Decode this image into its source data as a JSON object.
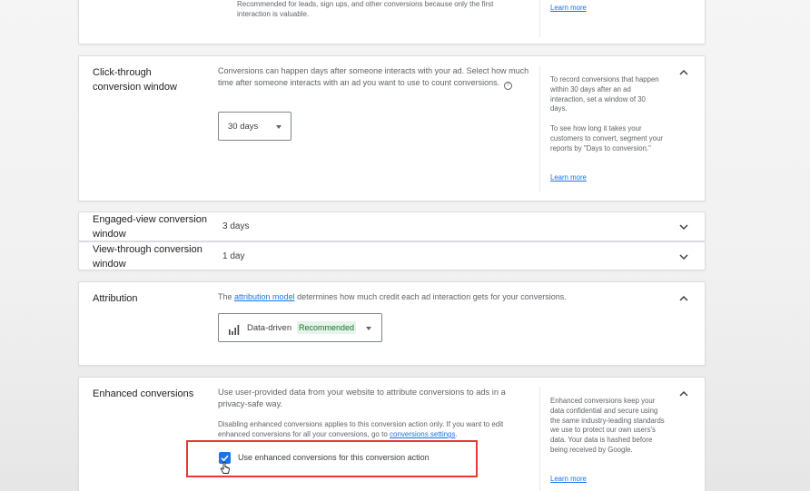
{
  "conversion_type_card": {
    "partial_text": "Recommended for leads, sign ups, and other conversions because only the first interaction is valuable.",
    "learn_more": "Learn more"
  },
  "click_through": {
    "title": "Click-through conversion window",
    "description": "Conversions can happen days after someone interacts with your ad. Select how much time after someone interacts with an ad you want to use to count conversions.",
    "select_value": "30 days",
    "help_para1": "To record conversions that happen within 30 days after an ad interaction, set a window of 30 days.",
    "help_para2": "To see how long it takes your customers to convert, segment your reports by \"Days to conversion.\"",
    "learn_more": "Learn more"
  },
  "engaged_view": {
    "title": "Engaged-view conversion window",
    "value": "3 days"
  },
  "view_through": {
    "title": "View-through conversion window",
    "value": "1 day"
  },
  "attribution": {
    "title": "Attribution",
    "desc_prefix": "The",
    "desc_link": "attribution model",
    "desc_suffix": "determines how much credit each ad interaction gets for your conversions.",
    "select_value": "Data-driven",
    "recommended_badge": "Recommended"
  },
  "enhanced": {
    "title": "Enhanced conversions",
    "description": "Use user-provided data from your website to attribute conversions to ads in a privacy-safe way.",
    "note_prefix": "Disabling enhanced conversions applies to this conversion action only. If you want to edit enhanced conversions for all your conversions, go to",
    "note_link": "conversions settings",
    "note_suffix": ".",
    "checkbox_label": "Use enhanced conversions for this conversion action",
    "checkbox_checked": true,
    "help_text": "Enhanced conversions keep your data confidential and secure using the same industry-leading standards we use to protect our own users's data. Your data is hashed before being received by Google.",
    "learn_more": "Learn more"
  },
  "colors": {
    "link": "#1a73e8",
    "checkbox": "#1a73e8",
    "recommended_bg": "#e6f4ea",
    "recommended_text": "#137333",
    "highlight_box": "#e53935"
  }
}
